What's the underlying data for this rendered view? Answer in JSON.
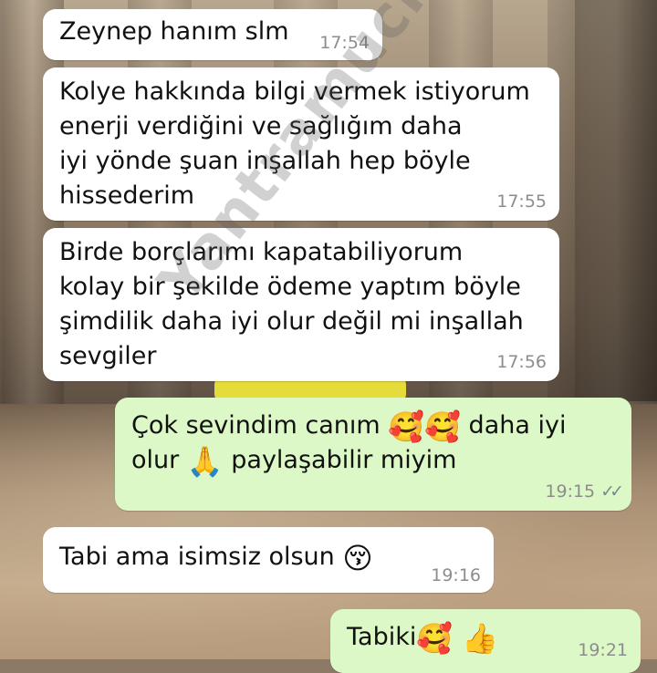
{
  "watermark": "Yantramucizesi",
  "messages": [
    {
      "direction": "in",
      "text": "Zeynep hanım slm",
      "time": "17:54"
    },
    {
      "direction": "in",
      "text": "Kolye hakkında bilgi vermek istiyorum\nenerji verdiğini ve sağlığım daha\niyi yönde şuan inşallah hep böyle\nhissederim",
      "time": "17:55"
    },
    {
      "direction": "in",
      "text": "Birde borçlarımı kapatabiliyorum\nkolay bir şekilde ödeme yaptım böyle\nşimdilik daha iyi olur değil mi inşallah\nsevgiler",
      "time": "17:56"
    },
    {
      "direction": "out",
      "text_line1_a": "Çok sevindim canım ",
      "emoji1": "🥰🥰",
      "text_line1_b": " daha iyi",
      "text_line2_a": "olur ",
      "emoji2": "🙏",
      "text_line2_b": " paylaşabilir miyim",
      "time": "19:15",
      "status": "read"
    },
    {
      "direction": "in",
      "text": "Tabi ama isimsiz olsun ",
      "emoji": "😚",
      "time": "19:16"
    },
    {
      "direction": "out",
      "text": "Tabiki",
      "emoji": "🥰 👍",
      "time": "19:21"
    }
  ],
  "icons": {
    "read_ticks": "double-check-icon"
  },
  "colors": {
    "incoming_bubble": "#ffffff",
    "outgoing_bubble": "#dcf8c6",
    "timestamp": "#8d8d8d"
  }
}
